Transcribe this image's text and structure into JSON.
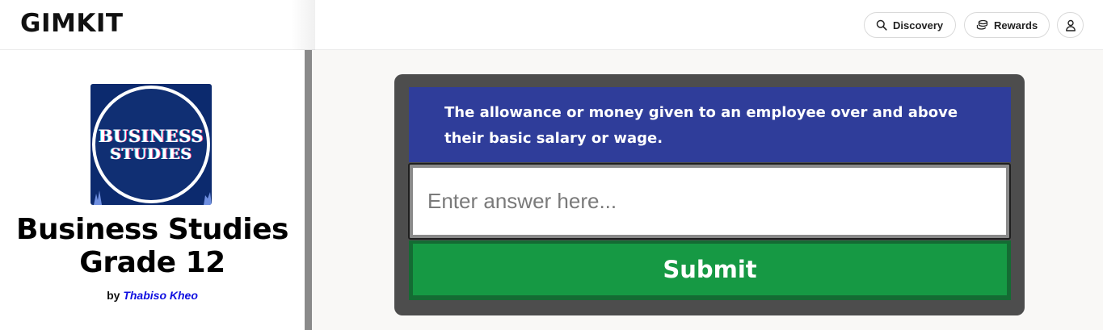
{
  "header": {
    "logo": "GIMKIT",
    "discovery_label": "Discovery",
    "rewards_label": "Rewards"
  },
  "kit": {
    "cover_line1": "BUSINESS",
    "cover_line2": "STUDIES",
    "title": "Business Studies Grade 12",
    "by_label": "by",
    "author": "Thabiso Kheo"
  },
  "question": {
    "text": "The allowance or money given to an employee over and above their basic salary or wage.",
    "answer_value": "",
    "answer_placeholder": "Enter answer here...",
    "submit_label": "Submit"
  },
  "colors": {
    "question_bg": "#2f3d9a",
    "submit_bg": "#169944",
    "card_bg": "#4d4d4d",
    "author_link": "#1010e0"
  },
  "icons": {
    "discovery": "search-icon",
    "rewards": "coins-icon",
    "account": "user-icon"
  }
}
